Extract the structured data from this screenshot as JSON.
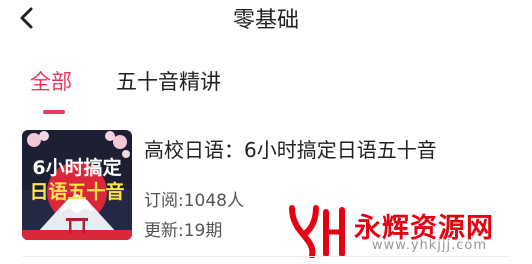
{
  "header": {
    "title": "零基础",
    "back_icon": "chevron-left-icon"
  },
  "tabs": [
    {
      "label": "全部",
      "active": true
    },
    {
      "label": "五十音精讲",
      "active": false
    }
  ],
  "accent_color": "#e8365d",
  "course": {
    "title": "高校日语：6小时搞定日语五十音",
    "subscribers": "订阅:1048人",
    "updates": "更新:19期",
    "cover": {
      "line1": "6小时搞定",
      "line2": "日语五十音"
    }
  },
  "watermark": {
    "text": "永辉资源网",
    "url": "www.yhkjjj.com",
    "logo": "yh-logo-icon",
    "color": "#e60012"
  }
}
